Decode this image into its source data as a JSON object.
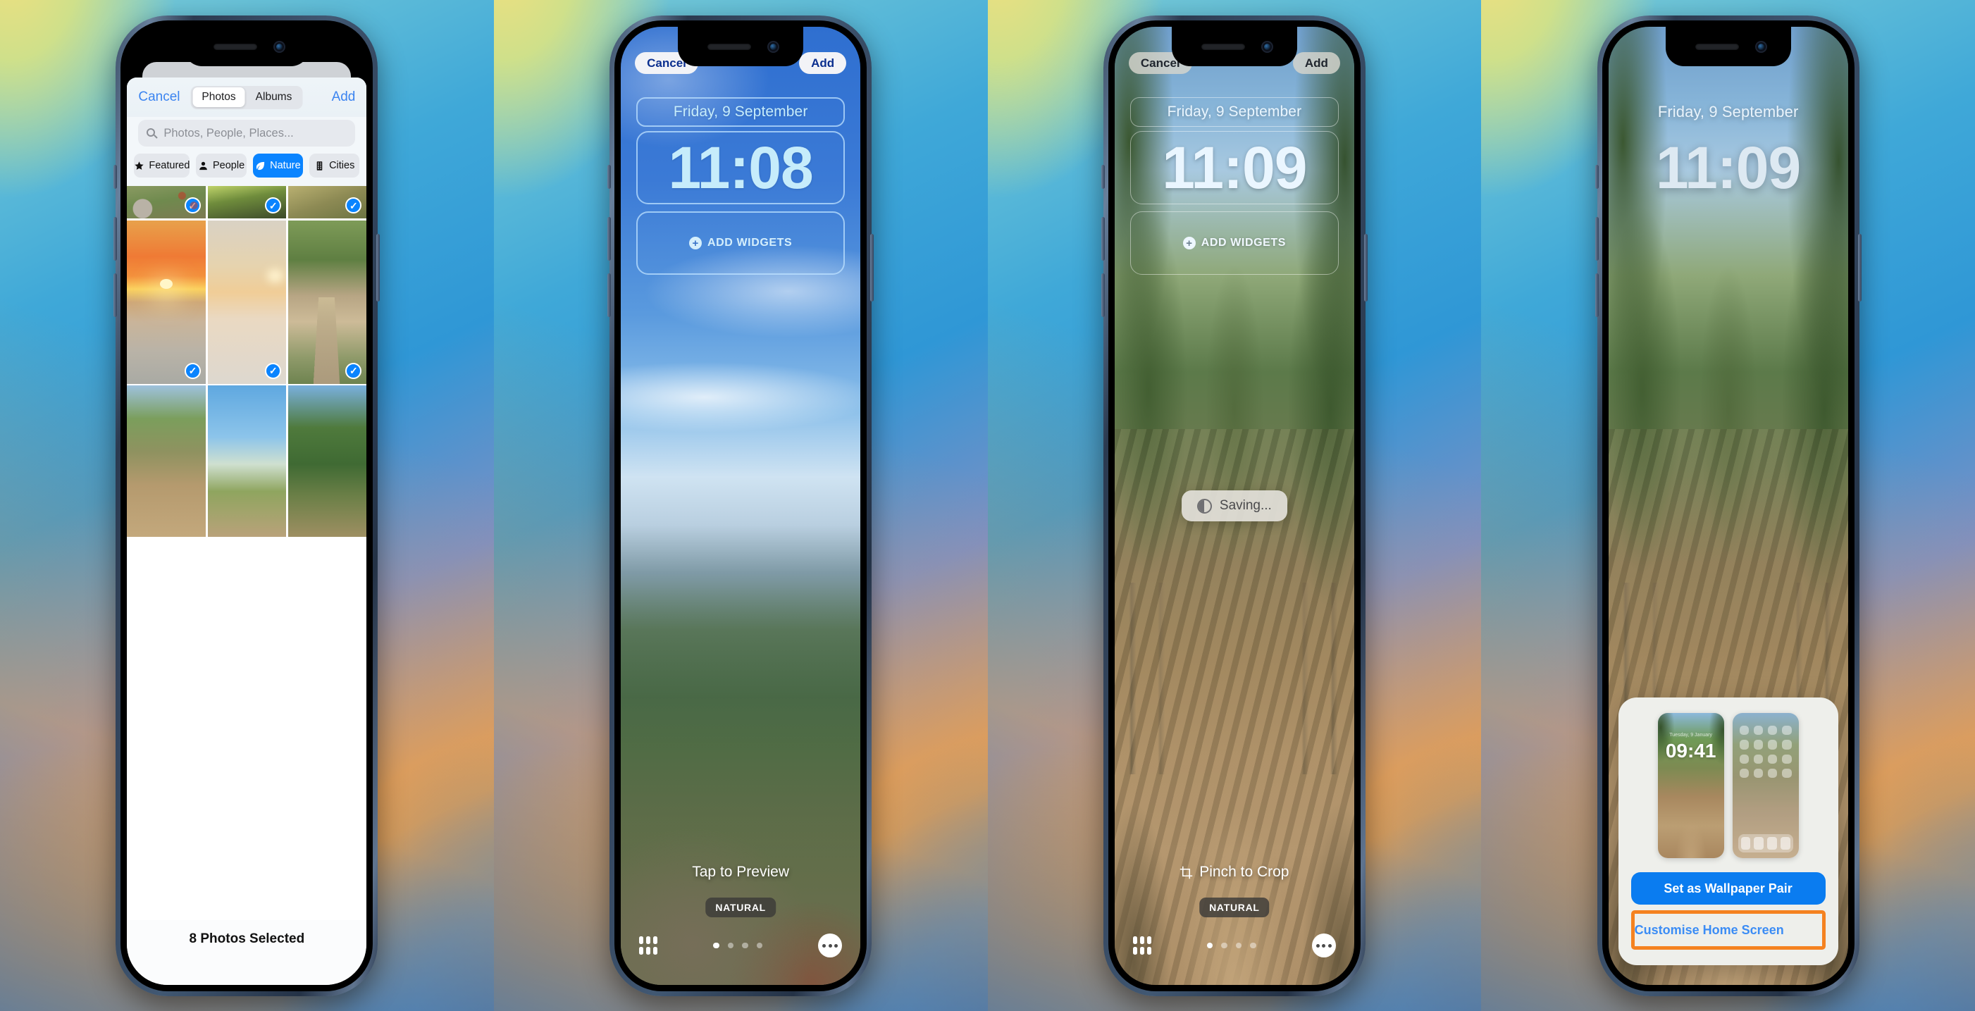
{
  "panels": [
    {
      "id": "photo-picker",
      "picker": {
        "cancel_label": "Cancel",
        "add_label": "Add",
        "segments": [
          {
            "label": "Photos",
            "active": true
          },
          {
            "label": "Albums",
            "active": false
          }
        ],
        "search_placeholder": "Photos, People, Places...",
        "filters": [
          {
            "label": "Featured",
            "icon": "star-icon",
            "active": false
          },
          {
            "label": "People",
            "icon": "person-icon",
            "active": false
          },
          {
            "label": "Nature",
            "icon": "leaf-icon",
            "active": true
          },
          {
            "label": "Cities",
            "icon": "building-icon",
            "active": false
          }
        ],
        "footer_status": "8 Photos Selected",
        "thumbnails": [
          {
            "style": "t-flowers",
            "selected": true,
            "row": 1
          },
          {
            "style": "t-bush",
            "selected": true,
            "row": 1
          },
          {
            "style": "t-grass",
            "selected": true,
            "row": 1
          },
          {
            "style": "t-sunset",
            "selected": true,
            "row": 2
          },
          {
            "style": "t-sunset2",
            "selected": true,
            "row": 2
          },
          {
            "style": "t-board",
            "selected": true,
            "row": 2
          },
          {
            "style": "t-path",
            "selected": false,
            "row": 3
          },
          {
            "style": "t-sky",
            "selected": false,
            "row": 3
          },
          {
            "style": "t-trees",
            "selected": false,
            "row": 3
          }
        ],
        "tick_glyph": "✓"
      }
    },
    {
      "id": "lockscreen-edit-blue",
      "cancel_label": "Cancel",
      "add_label": "Add",
      "date": "Friday, 9 September",
      "time": "11:08",
      "add_widgets_label": "ADD WIDGETS",
      "plus_glyph": "+",
      "hint_text": "Tap to Preview",
      "style_chip": "NATURAL",
      "page_dots": 4,
      "active_dot": 1
    },
    {
      "id": "lockscreen-edit-forest",
      "cancel_label": "Cancel",
      "add_label": "Add",
      "date": "Friday, 9 September",
      "time": "11:09",
      "add_widgets_label": "ADD WIDGETS",
      "plus_glyph": "+",
      "toast_text": "Saving...",
      "hint_text": "Pinch to Crop",
      "style_chip": "NATURAL",
      "page_dots": 4,
      "active_dot": 1
    },
    {
      "id": "wallpaper-pair-sheet",
      "date": "Friday, 9 September",
      "time": "11:09",
      "sheet": {
        "lock_preview": {
          "date": "Tuesday, 9 January",
          "time": "09:41"
        },
        "primary_button": "Set as Wallpaper Pair",
        "secondary_button": "Customise Home Screen",
        "highlight_color": "#f58220"
      }
    }
  ],
  "colors": {
    "ios_blue": "#0a84ff",
    "link_blue": "#3b84f0",
    "highlight_orange": "#f58220",
    "clock_cyan": "#c6ecfb"
  }
}
